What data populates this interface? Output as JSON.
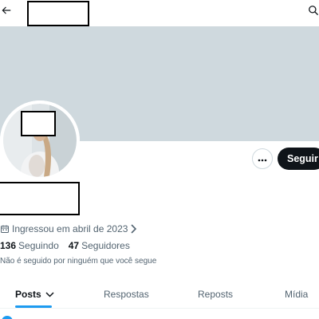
{
  "header": {
    "back_icon": "arrow-left-icon",
    "search_icon": "search-icon"
  },
  "profile": {
    "follow_label": "Seguir",
    "more_icon": "more-horizontal-icon",
    "joined_text": "Ingressou em abril de 2023",
    "calendar_icon": "calendar-icon",
    "following_count": "136",
    "following_label": "Seguindo",
    "followers_count": "47",
    "followers_label": "Seguidores",
    "not_followed_notice": "Não é seguido por ninguém que você segue"
  },
  "tabs": [
    {
      "label": "Posts",
      "active": true
    },
    {
      "label": "Respostas",
      "active": false
    },
    {
      "label": "Reposts",
      "active": false
    },
    {
      "label": "Mídia",
      "active": false
    }
  ],
  "colors": {
    "banner": "#cfd9de",
    "accent": "#1d9bf0",
    "text_primary": "#0f1419",
    "text_secondary": "#536471",
    "follow_button_bg": "#0f1419"
  }
}
